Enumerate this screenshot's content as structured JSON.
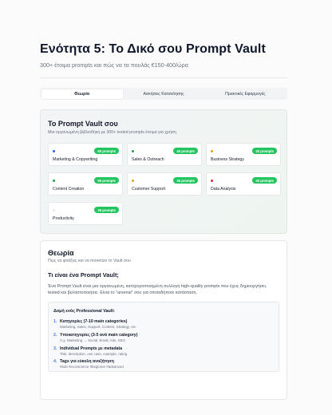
{
  "header": {
    "title": "Ενότητα 5: Το Δικό σου Prompt Vault",
    "subtitle": "300+ έτοιμα prompts και πώς να τα πουλάς €150-400/ώρα"
  },
  "tabs": [
    {
      "label": "Θεωρία",
      "active": true
    },
    {
      "label": "Ασκήσεις Κατανόησης",
      "active": false
    },
    {
      "label": "Πρακτικές Εφαρμογές",
      "active": false
    }
  ],
  "vault": {
    "title": "Το Prompt Vault σου",
    "description": "Μια οργανωμένη βιβλιοθήκη με 300+ tested prompts έτοιμα για χρήση",
    "categories": [
      {
        "name": "Marketing & Copywriting",
        "count": "60 prompts",
        "dot_color": "#2563eb"
      },
      {
        "name": "Sales & Outreach",
        "count": "45 prompts",
        "dot_color": "#16a34a"
      },
      {
        "name": "Business Strategy",
        "count": "40 prompts",
        "dot_color": "#f59e0b"
      },
      {
        "name": "Content Creation",
        "count": "55 prompts",
        "dot_color": "#16a34a"
      },
      {
        "name": "Customer Support",
        "count": "35 prompts",
        "dot_color": "#f59e0b"
      },
      {
        "name": "Data Analysis",
        "count": "30 prompts",
        "dot_color": "#dc2626"
      },
      {
        "name": "Productivity",
        "count": "35 prompts",
        "dot_color": "#e5e7eb"
      }
    ]
  },
  "theory": {
    "title": "Θεωρία",
    "description": "Πώς να φτιάξεις και να monetize το Vault σου",
    "question": "Τι είναι ένα Prompt Vault;",
    "paragraph": "Ένα Prompt Vault είναι μια οργανωμένη, κατηγοριοποιημένη συλλογή high-quality prompts που έχεις δημιουργήσει, tested και βελτιστοποιήσει. Είναι το \"arsenal\" σου για οποιαδήποτε κατάσταση.",
    "structure": {
      "title": "Δομή ενός Professional Vault:",
      "items": [
        {
          "num": "1.",
          "title": "Κατηγορίες (7-10 main categories)",
          "detail": "Marketing, Sales, Support, Content, Strategy, etc."
        },
        {
          "num": "2.",
          "title": "Υποκατηγορίες (3-5 ανά main category)",
          "detail": "π.χ. Marketing → Social, Email, Ads, SEO"
        },
        {
          "num": "3.",
          "title": "Individual Prompts με metadata",
          "detail": "Title, description, use case, example, rating"
        },
        {
          "num": "4.",
          "title": "Tags για εύκολη αναζήτηση",
          "detail": "#b2b #ecommerce #beginner #advanced"
        }
      ]
    }
  }
}
